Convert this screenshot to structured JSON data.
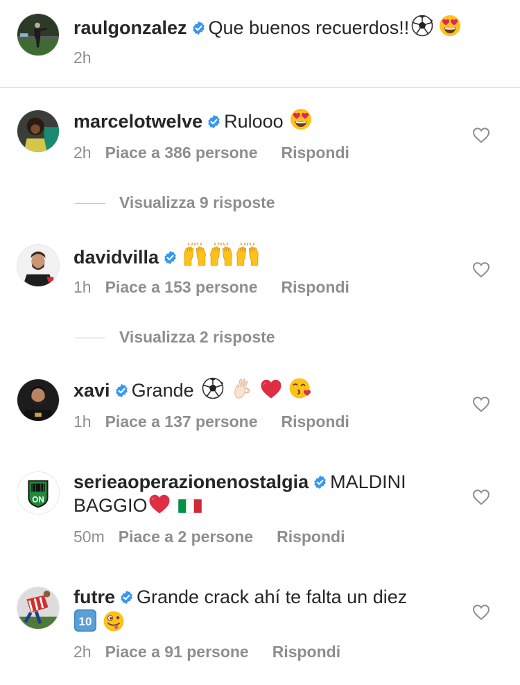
{
  "caption": {
    "username": "raulgonzalez",
    "text": "Que buenos recuerdos!!",
    "emojis": [
      "soccer-ball",
      "heart-eyes"
    ],
    "time": "2h"
  },
  "comments": [
    {
      "username": "marcelotwelve",
      "text": "Rulooo",
      "emojis": [
        "heart-eyes"
      ],
      "time": "2h",
      "likes": "Piace a 386 persone",
      "reply_label": "Rispondi",
      "view_replies": "Visualizza 9 risposte"
    },
    {
      "username": "davidvilla",
      "text": "",
      "emojis": [
        "raising-hands",
        "raising-hands",
        "raising-hands"
      ],
      "time": "1h",
      "likes": "Piace a 153 persone",
      "reply_label": "Rispondi",
      "view_replies": "Visualizza 2 risposte"
    },
    {
      "username": "xavi",
      "text": "Grande",
      "emojis": [
        "soccer-ball",
        "ok-hand",
        "red-heart",
        "kissing-face"
      ],
      "time": "1h",
      "likes": "Piace a 137 persone",
      "reply_label": "Rispondi"
    },
    {
      "username": "serieaoperazionenostalgia",
      "text": "MALDINI",
      "text_line2": "BAGGIO",
      "emojis": [
        "red-heart",
        "italy-flag"
      ],
      "time": "50m",
      "likes": "Piace a 2 persone",
      "reply_label": "Rispondi"
    },
    {
      "username": "futre",
      "text": "Grande crack ahí te falta un diez",
      "emojis": [
        "keycap-ten",
        "winking-tongue-face"
      ],
      "time": "2h",
      "likes": "Piace a 91 persone",
      "reply_label": "Rispondi"
    }
  ],
  "colors": {
    "verified": "#3897f0",
    "secondary_text": "#8e8e8e",
    "primary_text": "#262626"
  }
}
